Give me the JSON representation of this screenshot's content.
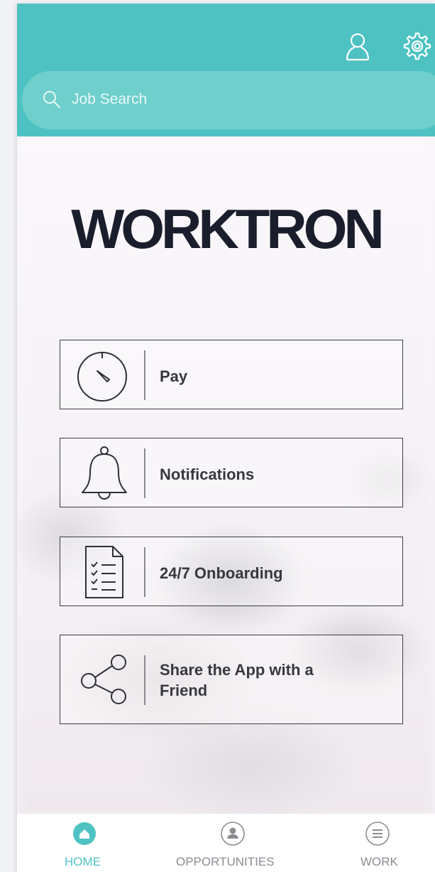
{
  "header": {
    "profile_icon": "person-outline-icon",
    "settings_icon": "gear-icon",
    "accent_color": "#4ec2c2"
  },
  "search": {
    "placeholder": "Job Search",
    "icon": "search-icon"
  },
  "brand": {
    "logo_text": "WORKTRON"
  },
  "menu": [
    {
      "label": "Pay",
      "icon": "stopwatch-icon"
    },
    {
      "label": "Notifications",
      "icon": "bell-icon"
    },
    {
      "label": "24/7 Onboarding",
      "icon": "checklist-document-icon"
    },
    {
      "label": "Share the App with a Friend",
      "icon": "share-icon"
    }
  ],
  "tabs": [
    {
      "label": "HOME",
      "icon": "home-icon",
      "active": true,
      "color": "#4ec2c2"
    },
    {
      "label": "OPPORTUNITIES",
      "icon": "person-circle-icon",
      "active": false,
      "color": "#8b8b92"
    },
    {
      "label": "WORK",
      "icon": "list-circle-icon",
      "active": false,
      "color": "#8b8b92"
    }
  ]
}
